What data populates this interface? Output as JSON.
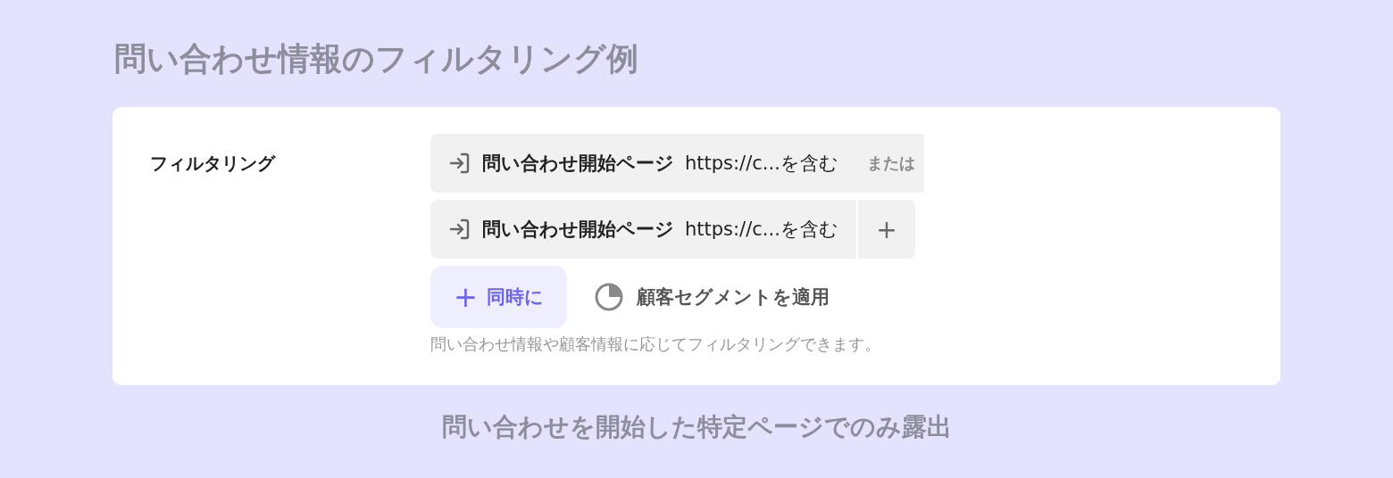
{
  "heading": "問い合わせ情報のフィルタリング例",
  "card": {
    "label": "フィルタリング",
    "filters": [
      {
        "field": "問い合わせ開始ページ",
        "condition": "https://c...を含む",
        "trailing": {
          "kind": "or",
          "text": "または"
        }
      },
      {
        "field": "問い合わせ開始ページ",
        "condition": "https://c...を含む",
        "trailing": {
          "kind": "add",
          "text": "+"
        }
      }
    ],
    "and_button": {
      "icon": "+",
      "label": "同時に"
    },
    "segment_button": {
      "label": "顧客セグメントを適用"
    },
    "hint": "問い合わせ情報や顧客情報に応じてフィルタリングできます。"
  },
  "caption": "問い合わせを開始した特定ページでのみ露出"
}
